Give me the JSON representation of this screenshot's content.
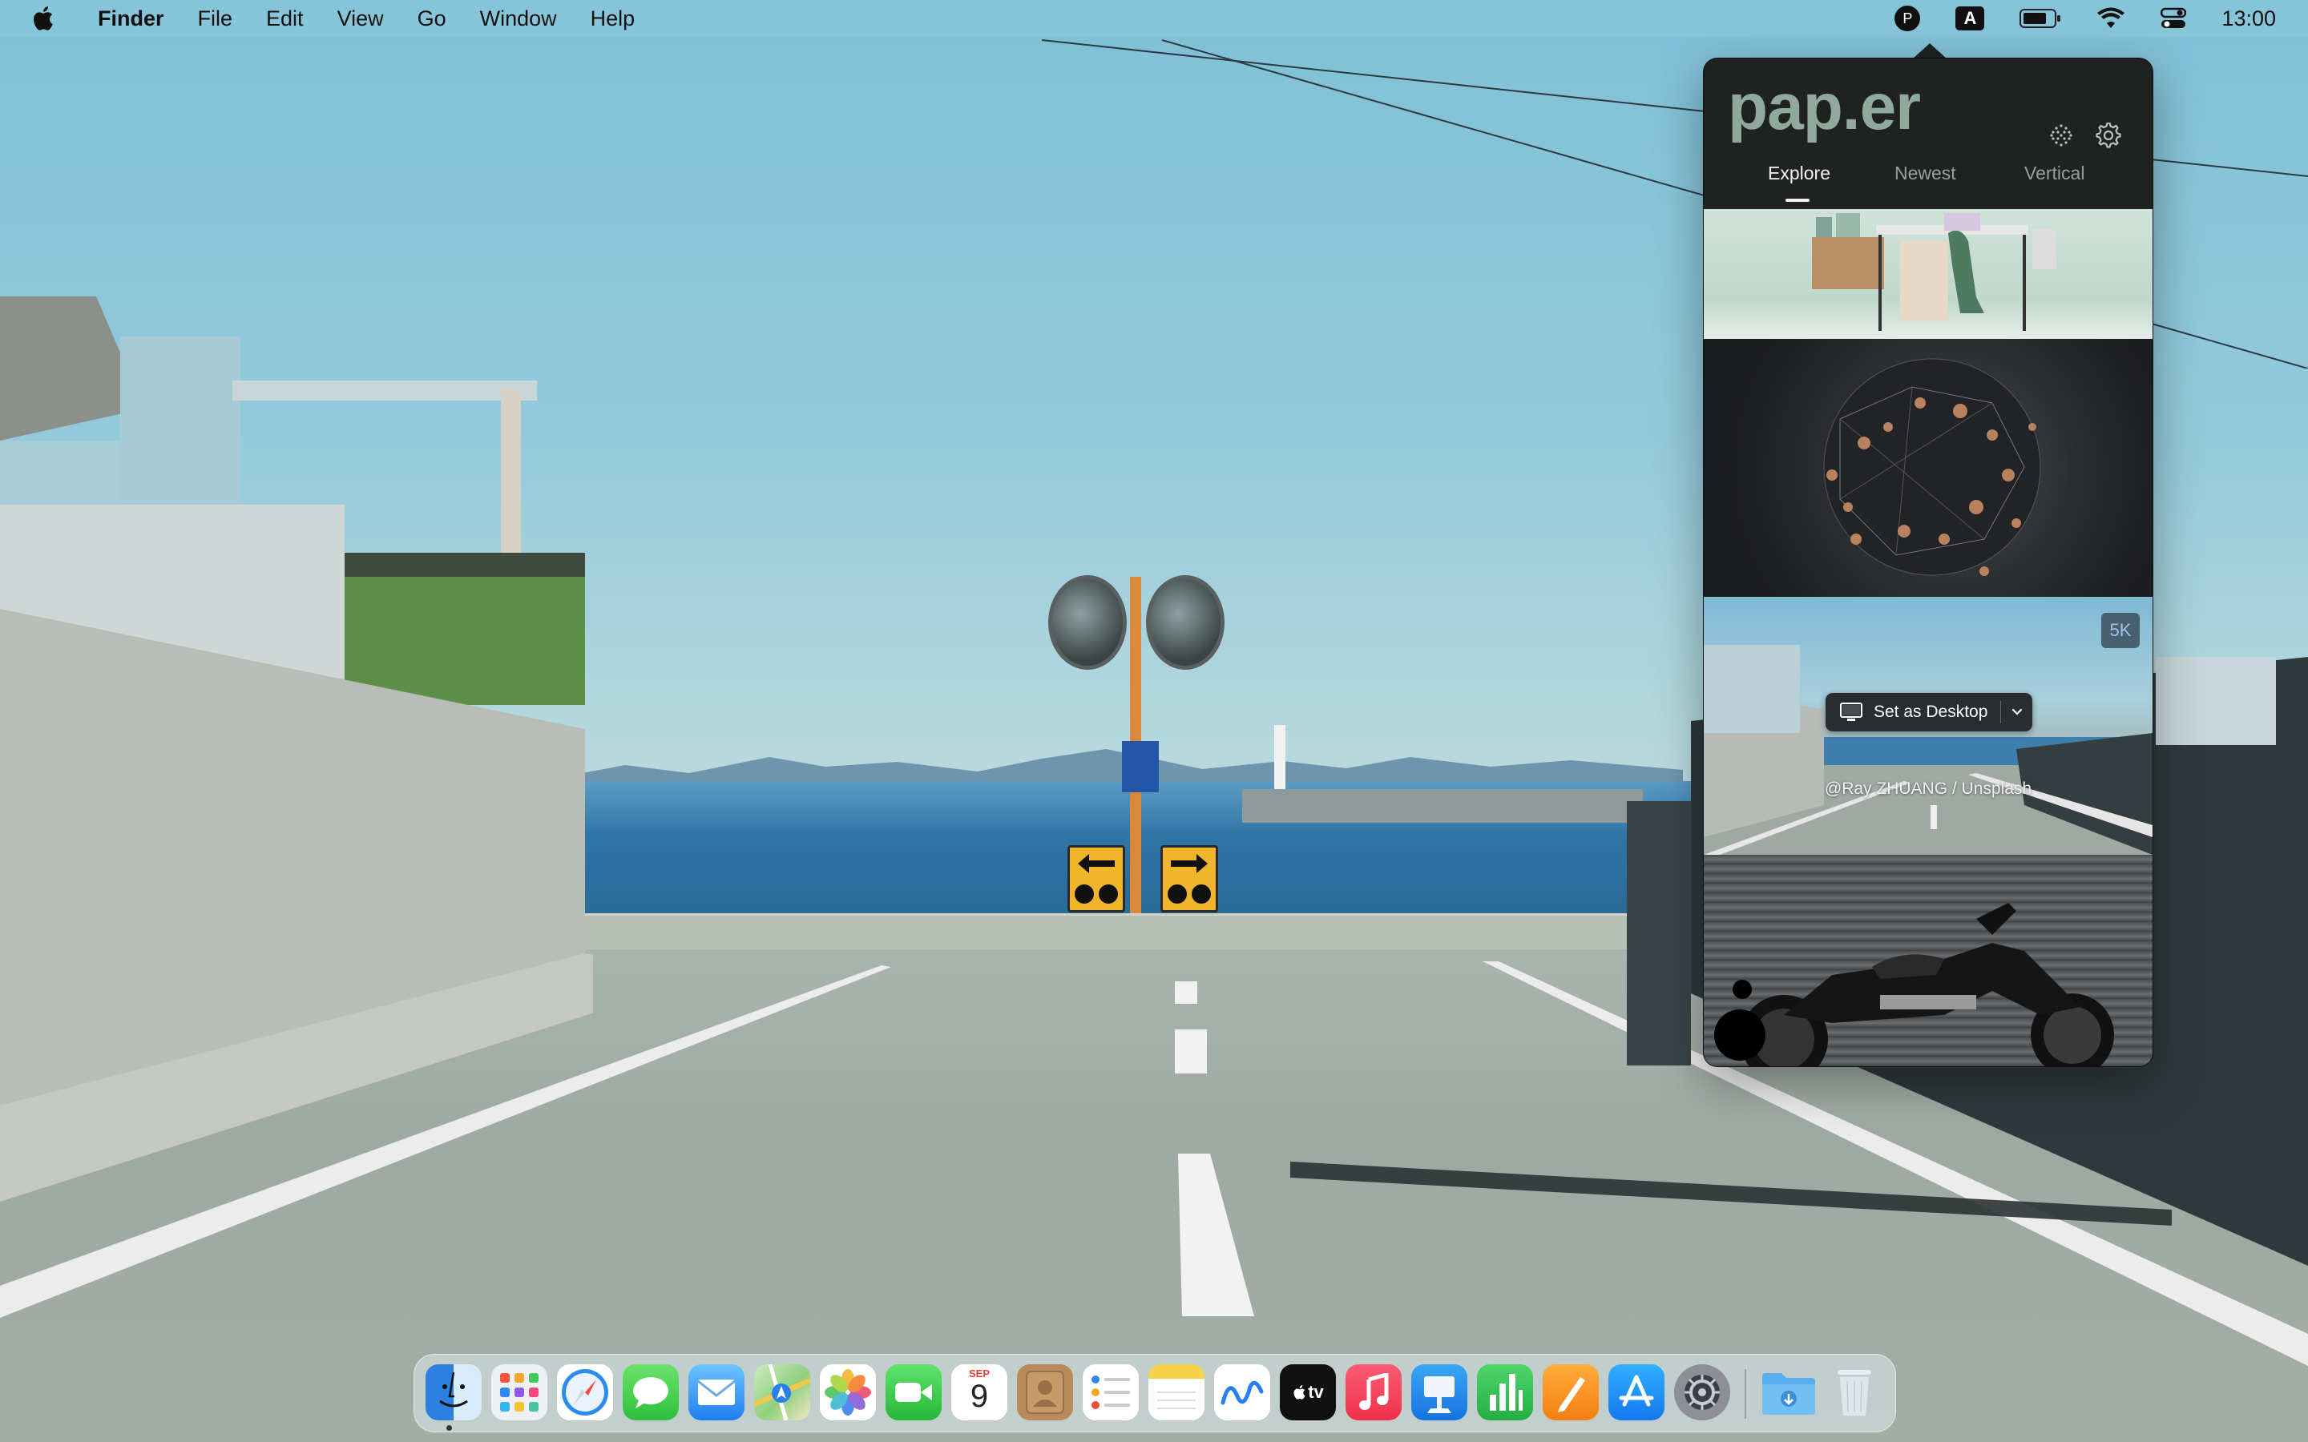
{
  "menubar": {
    "app_name": "Finder",
    "menus": [
      "File",
      "Edit",
      "View",
      "Go",
      "Window",
      "Help"
    ],
    "status": {
      "paper_menu_letter": "P",
      "input_source_letter": "A",
      "clock": "13:00"
    }
  },
  "paper": {
    "logo": "pap.er",
    "tabs": [
      "Explore",
      "Newest",
      "Vertical"
    ],
    "active_tab": "Explore",
    "hover_item": {
      "resolution_badge": "5K",
      "set_button_label": "Set as Desktop",
      "credit": "@Ray ZHUANG / Unsplash"
    }
  },
  "dock": {
    "apps": [
      "finder-icon",
      "launchpad-icon",
      "safari-icon",
      "messages-icon",
      "mail-icon",
      "maps-icon",
      "photos-icon",
      "facetime-icon",
      "calendar-icon",
      "contacts-icon",
      "reminders-icon",
      "notes-icon",
      "freeform-icon",
      "apple-tv-icon",
      "music-icon",
      "keynote-icon",
      "numbers-icon",
      "pages-icon",
      "app-store-icon",
      "system-settings-icon",
      "downloads-folder-icon",
      "trash-icon"
    ],
    "calendar": {
      "month": "SEP",
      "day": "9"
    },
    "tv_label": "tv"
  }
}
